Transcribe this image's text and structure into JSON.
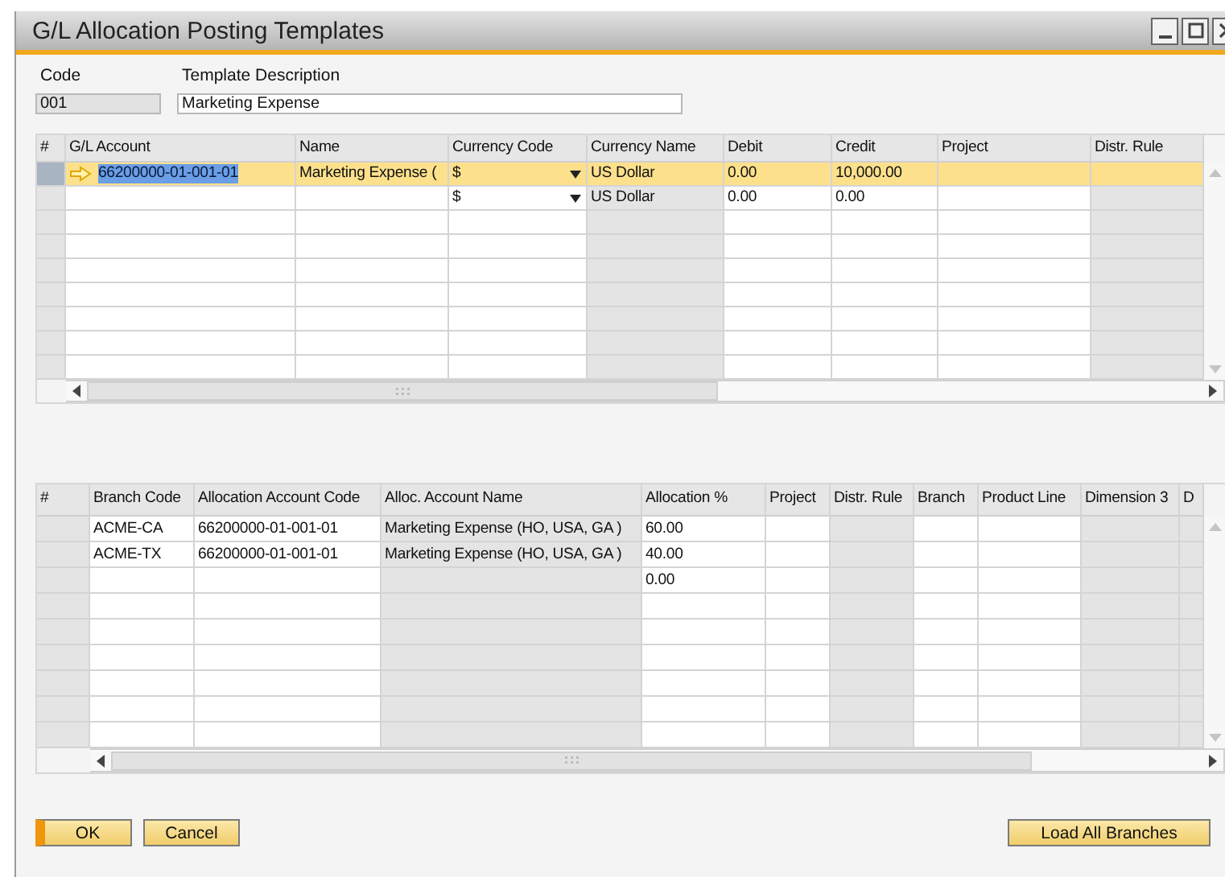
{
  "window": {
    "title": "G/L Allocation Posting Templates"
  },
  "header": {
    "code_label": "Code",
    "code_value": "001",
    "description_label": "Template Description",
    "description_value": "Marketing Expense"
  },
  "lines_table": {
    "columns": [
      {
        "label": "#",
        "kind": "row_number"
      },
      {
        "label": "G/L Account",
        "kind": "linked"
      },
      {
        "label": "Name",
        "kind": "input"
      },
      {
        "label": "Currency Code",
        "kind": "dropdown"
      },
      {
        "label": "Currency Name",
        "kind": "readonly"
      },
      {
        "label": "Debit",
        "kind": "input"
      },
      {
        "label": "Credit",
        "kind": "input"
      },
      {
        "label": "Project",
        "kind": "input"
      },
      {
        "label": "Distr. Rule",
        "kind": "readonly"
      }
    ],
    "rows": [
      {
        "selected": true,
        "text_highlighted": true,
        "cells": [
          "",
          "66200000-01-001-01",
          "Marketing Expense (",
          "$",
          "US Dollar",
          "0.00",
          "10,000.00",
          "",
          ""
        ]
      },
      {
        "selected": false,
        "cells": [
          "",
          "",
          "",
          "$",
          "US Dollar",
          "0.00",
          "0.00",
          "",
          ""
        ]
      }
    ]
  },
  "allocation_table": {
    "columns": [
      {
        "label": "#",
        "kind": "row_number"
      },
      {
        "label": "Branch Code",
        "kind": "input"
      },
      {
        "label": "Allocation Account Code",
        "kind": "input"
      },
      {
        "label": "Alloc. Account Name",
        "kind": "readonly"
      },
      {
        "label": "Allocation %",
        "kind": "input"
      },
      {
        "label": "Project",
        "kind": "input"
      },
      {
        "label": "Distr. Rule",
        "kind": "readonly"
      },
      {
        "label": "Branch",
        "kind": "input"
      },
      {
        "label": "Product Line",
        "kind": "input"
      },
      {
        "label": "Dimension 3",
        "kind": "readonly"
      },
      {
        "label": "D",
        "kind": "readonly"
      }
    ],
    "rows": [
      {
        "selected": false,
        "cells": [
          "",
          "ACME-CA",
          "66200000-01-001-01",
          "Marketing Expense (HO, USA, GA )",
          "60.00",
          "",
          "",
          "",
          "",
          "",
          ""
        ]
      },
      {
        "selected": false,
        "cells": [
          "",
          "ACME-TX",
          "66200000-01-001-01",
          "Marketing Expense (HO, USA, GA )",
          "40.00",
          "",
          "",
          "",
          "",
          "",
          ""
        ]
      },
      {
        "selected": false,
        "cells": [
          "",
          "",
          "",
          "",
          "0.00",
          "",
          "",
          "",
          "",
          "",
          ""
        ]
      }
    ]
  },
  "buttons": [
    {
      "label": "OK",
      "default": true
    },
    {
      "label": "Cancel",
      "default": false
    },
    {
      "label": "Load All Branches",
      "default": false
    }
  ]
}
